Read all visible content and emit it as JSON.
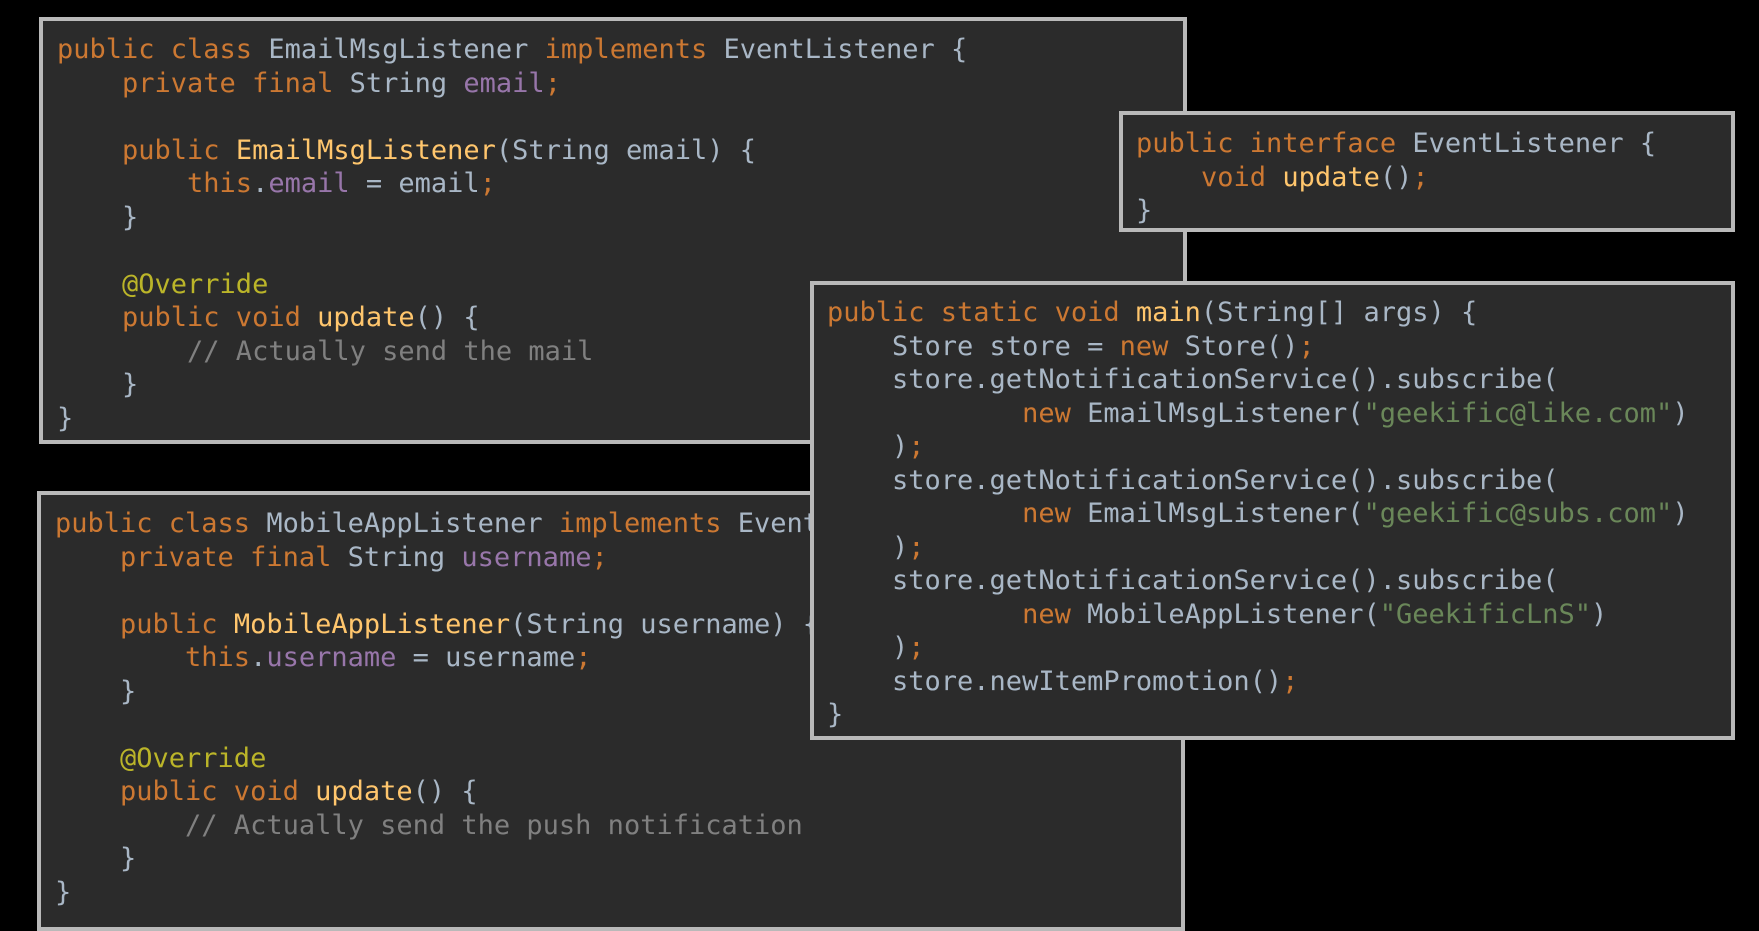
{
  "email_listener": {
    "lines": [
      [
        {
          "t": "public class ",
          "c": "kw"
        },
        {
          "t": "EmailMsgListener ",
          "c": "pl"
        },
        {
          "t": "implements ",
          "c": "kw"
        },
        {
          "t": "EventListener {",
          "c": "pl"
        }
      ],
      [
        {
          "t": "    private final ",
          "c": "kw"
        },
        {
          "t": "String ",
          "c": "pl"
        },
        {
          "t": "email",
          "c": "fld"
        },
        {
          "t": ";",
          "c": "semi"
        }
      ],
      [],
      [
        {
          "t": "    public ",
          "c": "kw"
        },
        {
          "t": "EmailMsgListener",
          "c": "fn"
        },
        {
          "t": "(String email) {",
          "c": "pl"
        }
      ],
      [
        {
          "t": "        this",
          "c": "kw"
        },
        {
          "t": ".",
          "c": "pl"
        },
        {
          "t": "email",
          "c": "fld"
        },
        {
          "t": " = email",
          "c": "pl"
        },
        {
          "t": ";",
          "c": "semi"
        }
      ],
      [
        {
          "t": "    }",
          "c": "pl"
        }
      ],
      [],
      [
        {
          "t": "    @Override",
          "c": "ann"
        }
      ],
      [
        {
          "t": "    public void ",
          "c": "kw"
        },
        {
          "t": "update",
          "c": "fn"
        },
        {
          "t": "() {",
          "c": "pl"
        }
      ],
      [
        {
          "t": "        // Actually send the mail",
          "c": "cmt"
        }
      ],
      [
        {
          "t": "    }",
          "c": "pl"
        }
      ],
      [
        {
          "t": "}",
          "c": "pl"
        }
      ]
    ]
  },
  "mobile_listener": {
    "lines": [
      [
        {
          "t": "public class ",
          "c": "kw"
        },
        {
          "t": "MobileAppListener ",
          "c": "pl"
        },
        {
          "t": "implements ",
          "c": "kw"
        },
        {
          "t": "EventListener {",
          "c": "pl"
        }
      ],
      [
        {
          "t": "    private final ",
          "c": "kw"
        },
        {
          "t": "String ",
          "c": "pl"
        },
        {
          "t": "username",
          "c": "fld"
        },
        {
          "t": ";",
          "c": "semi"
        }
      ],
      [],
      [
        {
          "t": "    public ",
          "c": "kw"
        },
        {
          "t": "MobileAppListener",
          "c": "fn"
        },
        {
          "t": "(String username) {",
          "c": "pl"
        }
      ],
      [
        {
          "t": "        this",
          "c": "kw"
        },
        {
          "t": ".",
          "c": "pl"
        },
        {
          "t": "username",
          "c": "fld"
        },
        {
          "t": " = username",
          "c": "pl"
        },
        {
          "t": ";",
          "c": "semi"
        }
      ],
      [
        {
          "t": "    }",
          "c": "pl"
        }
      ],
      [],
      [
        {
          "t": "    @Override",
          "c": "ann"
        }
      ],
      [
        {
          "t": "    public void ",
          "c": "kw"
        },
        {
          "t": "update",
          "c": "fn"
        },
        {
          "t": "() {",
          "c": "pl"
        }
      ],
      [
        {
          "t": "        // Actually send the push notification",
          "c": "cmt"
        }
      ],
      [
        {
          "t": "    }",
          "c": "pl"
        }
      ],
      [
        {
          "t": "}",
          "c": "pl"
        }
      ]
    ]
  },
  "event_interface": {
    "lines": [
      [
        {
          "t": "public interface ",
          "c": "kw"
        },
        {
          "t": "EventListener {",
          "c": "pl"
        }
      ],
      [
        {
          "t": "    void ",
          "c": "kw"
        },
        {
          "t": "update",
          "c": "fn"
        },
        {
          "t": "()",
          "c": "pl"
        },
        {
          "t": ";",
          "c": "semi"
        }
      ],
      [
        {
          "t": "}",
          "c": "pl"
        }
      ]
    ]
  },
  "main_method": {
    "lines": [
      [
        {
          "t": "public static void ",
          "c": "kw"
        },
        {
          "t": "main",
          "c": "fn"
        },
        {
          "t": "(String[] args) {",
          "c": "pl"
        }
      ],
      [
        {
          "t": "    Store store = ",
          "c": "pl"
        },
        {
          "t": "new ",
          "c": "kw"
        },
        {
          "t": "Store()",
          "c": "pl"
        },
        {
          "t": ";",
          "c": "semi"
        }
      ],
      [
        {
          "t": "    store.getNotificationService().subscribe(",
          "c": "pl"
        }
      ],
      [
        {
          "t": "            ",
          "c": "pl"
        },
        {
          "t": "new ",
          "c": "kw"
        },
        {
          "t": "EmailMsgListener(",
          "c": "pl"
        },
        {
          "t": "\"geekific@like.com\"",
          "c": "str"
        },
        {
          "t": ")",
          "c": "pl"
        }
      ],
      [
        {
          "t": "    )",
          "c": "pl"
        },
        {
          "t": ";",
          "c": "semi"
        }
      ],
      [
        {
          "t": "    store.getNotificationService().subscribe(",
          "c": "pl"
        }
      ],
      [
        {
          "t": "            ",
          "c": "pl"
        },
        {
          "t": "new ",
          "c": "kw"
        },
        {
          "t": "EmailMsgListener(",
          "c": "pl"
        },
        {
          "t": "\"geekific@subs.com\"",
          "c": "str"
        },
        {
          "t": ")",
          "c": "pl"
        }
      ],
      [
        {
          "t": "    )",
          "c": "pl"
        },
        {
          "t": ";",
          "c": "semi"
        }
      ],
      [
        {
          "t": "    store.getNotificationService().subscribe(",
          "c": "pl"
        }
      ],
      [
        {
          "t": "            ",
          "c": "pl"
        },
        {
          "t": "new ",
          "c": "kw"
        },
        {
          "t": "MobileAppListener(",
          "c": "pl"
        },
        {
          "t": "\"GeekificLnS\"",
          "c": "str"
        },
        {
          "t": ")",
          "c": "pl"
        }
      ],
      [
        {
          "t": "    )",
          "c": "pl"
        },
        {
          "t": ";",
          "c": "semi"
        }
      ],
      [
        {
          "t": "    store.newItemPromotion()",
          "c": "pl"
        },
        {
          "t": ";",
          "c": "semi"
        }
      ],
      [
        {
          "t": "}",
          "c": "pl"
        }
      ]
    ]
  },
  "colors": {
    "background": "#000000",
    "panel": "#2b2b2b",
    "border": "#b9b9b9",
    "keyword": "#cc7832",
    "function": "#ffc66d",
    "field": "#9876aa",
    "string": "#6a8759",
    "annotation": "#bbb529",
    "comment": "#808080",
    "plain": "#a9b7c6"
  }
}
